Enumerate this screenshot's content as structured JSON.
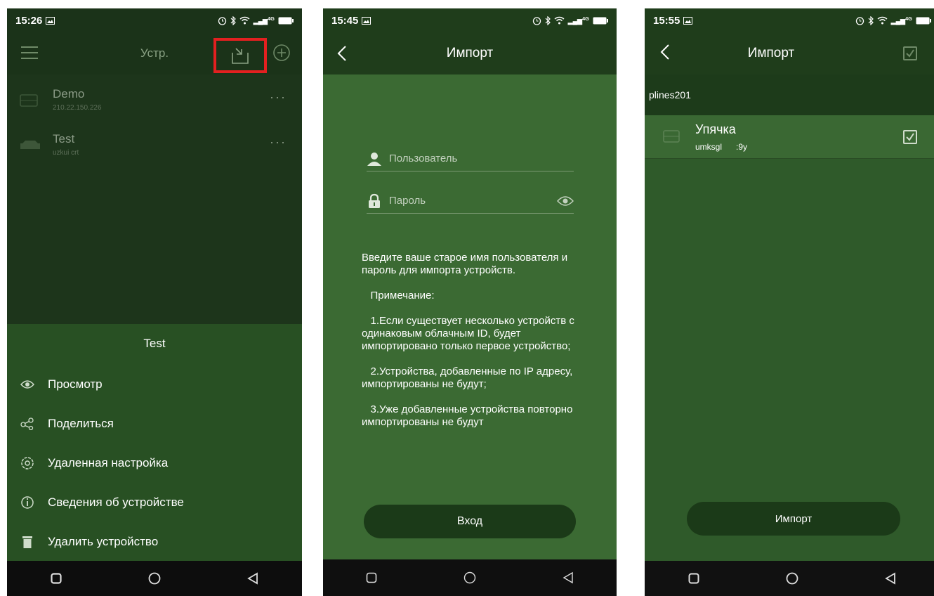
{
  "colors": {
    "dark_green": "#1b3319",
    "mid_green": "#3b6a33",
    "highlight_red": "#e32020"
  },
  "screen1": {
    "status_time": "15:26",
    "status_net": "4G",
    "title": "Устр.",
    "devices": [
      {
        "name": "Demo",
        "sub": "210.22.150.226"
      },
      {
        "name": "Test",
        "sub": "uzkui      crt"
      }
    ],
    "sheet_title": "Test",
    "menu": [
      {
        "label": "Просмотр",
        "icon": "eye-icon"
      },
      {
        "label": "Поделиться",
        "icon": "share-icon"
      },
      {
        "label": "Удаленная настройка",
        "icon": "settings-icon"
      },
      {
        "label": "Сведения об устройстве",
        "icon": "info-icon"
      },
      {
        "label": "Удалить устройство",
        "icon": "trash-icon"
      }
    ]
  },
  "screen2": {
    "status_time": "15:45",
    "status_net": "4G",
    "title": "Импорт",
    "username_placeholder": "Пользователь",
    "password_placeholder": "Пароль",
    "intro": "Введите ваше старое имя пользователя и пароль для импорта устройств.",
    "note_title": "   Примечание:",
    "note1": "   1.Если существует несколько устройств с одинаковым облачным ID, будет импортировано только первое устройство;",
    "note2": "   2.Устройства, добавленные по IP адресу, импортированы не будут;",
    "note3": "   3.Уже добавленные устройства повторно импортированы не будут",
    "login_button": "Вход"
  },
  "screen3": {
    "status_time": "15:55",
    "status_net": "4G",
    "title": "Импорт",
    "account": "plines201",
    "item_name": "Упячка",
    "item_sub": "umksgl      :9y",
    "import_button": "Импорт"
  }
}
